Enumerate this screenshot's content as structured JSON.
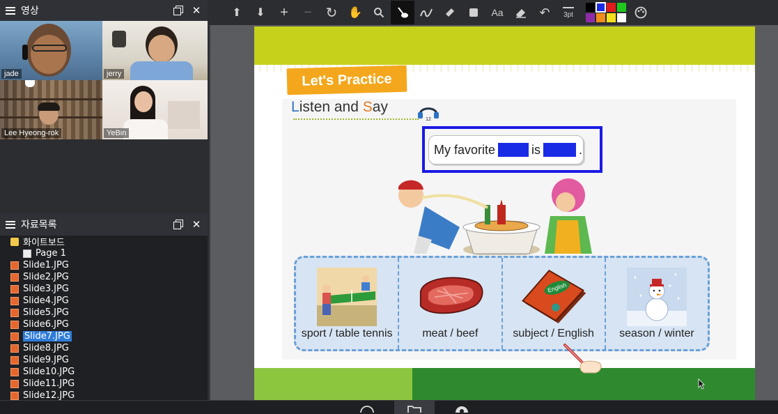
{
  "video_panel": {
    "title": "영상",
    "participants": [
      {
        "name": "jade"
      },
      {
        "name": "jerry"
      },
      {
        "name": "Lee Hyeong-rok"
      },
      {
        "name": "YeBin"
      }
    ]
  },
  "files_panel": {
    "title": "자료목록",
    "folder": "화이트보드",
    "page": "Page 1",
    "selected": "Slide7.JPG",
    "files": [
      "Slide1.JPG",
      "Slide2.JPG",
      "Slide3.JPG",
      "Slide4.JPG",
      "Slide5.JPG",
      "Slide6.JPG",
      "Slide7.JPG",
      "Slide8.JPG",
      "Slide9.JPG",
      "Slide10.JPG",
      "Slide11.JPG",
      "Slide12.JPG"
    ]
  },
  "toolbar": {
    "text_tool_label": "Aa",
    "stroke_size": "3pt",
    "colors": [
      "#000000",
      "#1a2be6",
      "#e31b1b",
      "#1ec81e",
      "#8e2ca8",
      "#f08c1a",
      "#f4e11a",
      "#ffffff"
    ],
    "selected_color": "#1a2be6"
  },
  "slide": {
    "banner": "Let's Practice",
    "section_title": {
      "first": "L",
      "middle1": "isten and ",
      "second": "S",
      "middle2": "ay"
    },
    "track_number": "12",
    "sentence": {
      "start": "My favorite",
      "middle": "is",
      "end": "."
    },
    "cards": [
      {
        "caption": "sport / table tennis"
      },
      {
        "caption": "meat / beef"
      },
      {
        "caption": "subject / English"
      },
      {
        "caption": "season / winter"
      }
    ],
    "book_label": "English"
  }
}
